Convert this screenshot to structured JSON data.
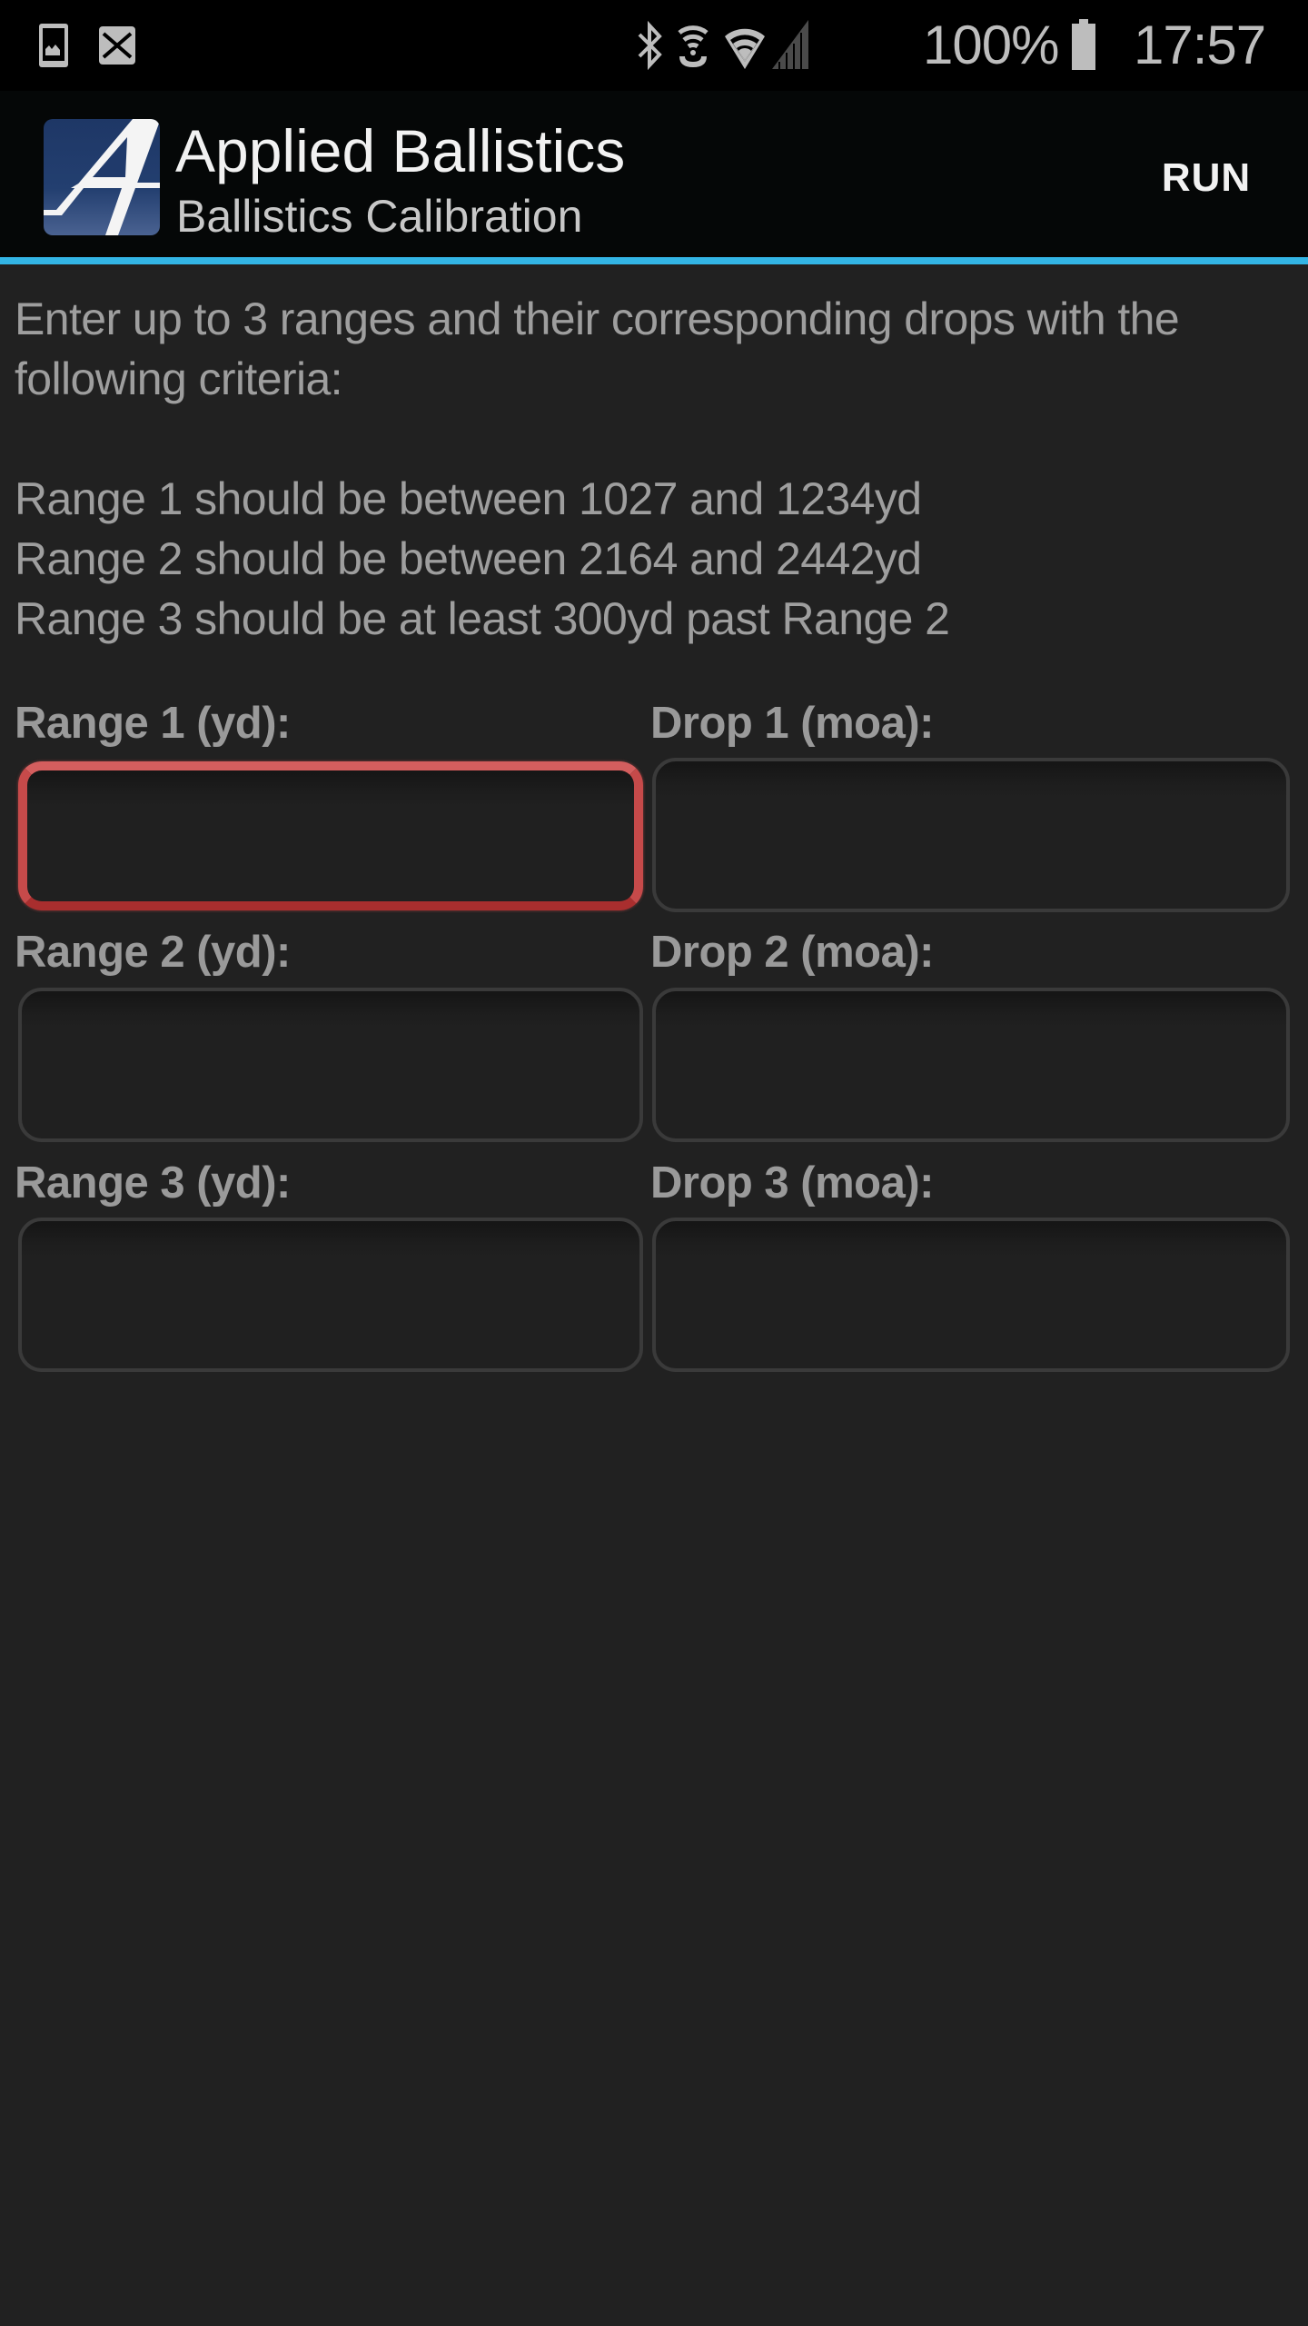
{
  "status_bar": {
    "notification_icons": [
      "gallery-icon",
      "mail-icon"
    ],
    "system_icons": [
      "bluetooth-icon",
      "hotspot-icon",
      "wifi-icon",
      "signal-icon",
      "battery-icon"
    ],
    "battery_percent": "100%",
    "time": "17:57"
  },
  "action_bar": {
    "title": "Applied Ballistics",
    "subtitle": "Ballistics Calibration",
    "run_label": "RUN",
    "accent_color": "#33b5e5"
  },
  "instructions": {
    "intro": "Enter up to 3 ranges and their corresponding drops with the following criteria:",
    "criteria": [
      "Range 1 should be between 1027 and 1234yd",
      "Range 2 should be between 2164 and 2442yd",
      "Range 3 should be at least 300yd past Range 2"
    ]
  },
  "form": {
    "rows": [
      {
        "range_label": "Range 1 (yd):",
        "range_value": "",
        "range_placeholder": "",
        "drop_label": "Drop 1 (moa):",
        "drop_value": "",
        "drop_placeholder": "",
        "range_focused": true
      },
      {
        "range_label": "Range 2 (yd):",
        "range_value": "",
        "range_placeholder": "",
        "drop_label": "Drop 2 (moa):",
        "drop_value": "",
        "drop_placeholder": ""
      },
      {
        "range_label": "Range 3 (yd):",
        "range_value": "",
        "range_placeholder": "",
        "drop_label": "Drop 3 (moa):",
        "drop_value": "",
        "drop_placeholder": ""
      }
    ],
    "focus_color": "#c64a4a"
  }
}
